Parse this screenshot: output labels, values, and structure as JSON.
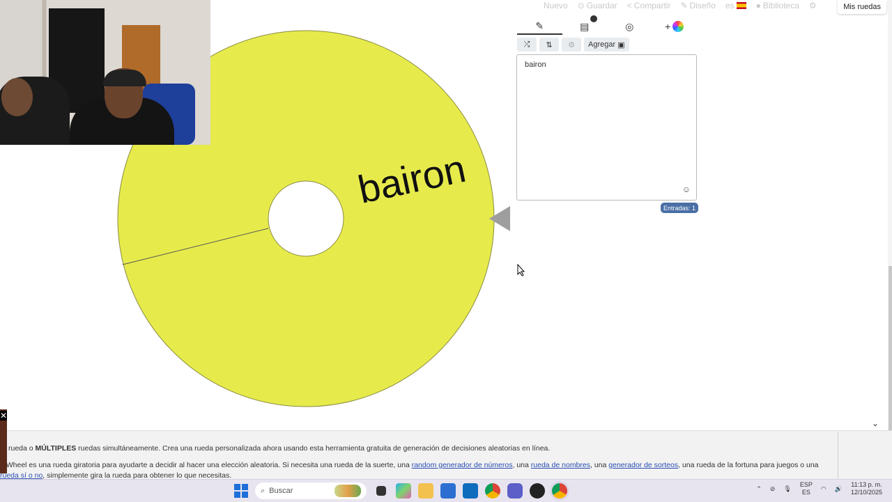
{
  "nav": {
    "new": "Nuevo",
    "save": "Guardar",
    "share": "Compartir",
    "design": "Diseño",
    "lang": "es",
    "library": "Biblioteca",
    "my_wheels": "Mis ruedas"
  },
  "wheel": {
    "segment_label": "bairon",
    "color": "#e6eb4b"
  },
  "editor": {
    "add_image_label": "Agregar",
    "entries_text": "bairon",
    "entries_count": "Entradas: 1"
  },
  "content": {
    "line1_pre": "rueda o ",
    "line1_bold": "MÚLTIPLES",
    "line1_post": " ruedas simultáneamente. Crea una rueda personalizada ahora usando esta herramienta gratuita de generación de decisiones aleatorias en línea.",
    "line2_pre": "e Wheel es una rueda giratoria para ayudarte a decidir al hacer una elección aleatoria. Si necesita una rueda de la suerte, una ",
    "link1": "random generador de números",
    "line2_mid1": ", una ",
    "link2": "rueda de nombres",
    "line2_mid2": ", una ",
    "link3": "generador de sorteos",
    "line2_post": ", una rueda de la fortuna para juegos o una",
    "link4": "rueda sí o no",
    "line3_post": ", simplemente gira la rueda para obtener lo que necesitas."
  },
  "taskbar": {
    "search_placeholder": "Buscar",
    "lang_top": "ESP",
    "lang_bottom": "ES",
    "time": "11:13 p. m.",
    "date": "12/10/2025"
  }
}
